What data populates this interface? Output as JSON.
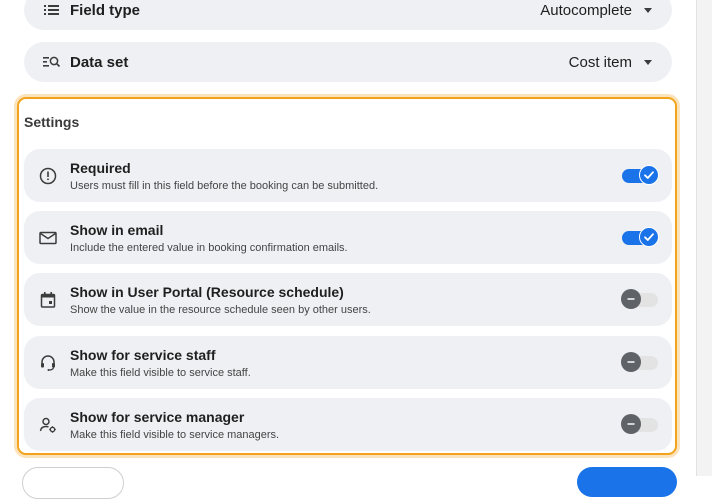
{
  "field_type": {
    "label": "Field type",
    "value": "Autocomplete",
    "icon": "list-icon"
  },
  "data_set": {
    "label": "Data set",
    "value": "Cost item",
    "icon": "search-list-icon"
  },
  "settings": {
    "title": "Settings",
    "items": [
      {
        "title": "Required",
        "desc": "Users must fill in this field before the booking can be submitted.",
        "icon": "alert-circle-icon",
        "enabled": true
      },
      {
        "title": "Show in email",
        "desc": "Include the entered value in booking confirmation emails.",
        "icon": "mail-icon",
        "enabled": true
      },
      {
        "title": "Show in User Portal (Resource schedule)",
        "desc": "Show the value in the resource schedule seen by other users.",
        "icon": "calendar-icon",
        "enabled": false
      },
      {
        "title": "Show for service staff",
        "desc": "Make this field visible to service staff.",
        "icon": "support-agent-icon",
        "enabled": false
      },
      {
        "title": "Show for service manager",
        "desc": "Make this field visible to service managers.",
        "icon": "manager-icon",
        "enabled": false
      }
    ]
  },
  "colors": {
    "accent": "#1a73e8",
    "highlight": "#f2a31b",
    "row_bg": "#eef0f4"
  }
}
